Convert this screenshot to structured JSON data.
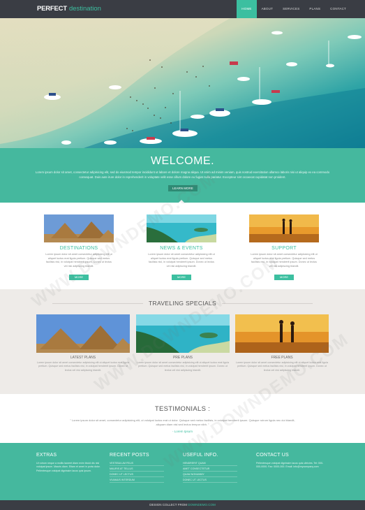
{
  "brand": {
    "logo_bold": "PERFECT",
    "logo_light": "destination"
  },
  "nav": {
    "items": [
      {
        "label": "HOME",
        "active": true
      },
      {
        "label": "ABOUT",
        "active": false
      },
      {
        "label": "SERVICES",
        "active": false
      },
      {
        "label": "PLANS",
        "active": false
      },
      {
        "label": "CONTACT",
        "active": false
      }
    ]
  },
  "welcome": {
    "title": "WELCOME.",
    "text": "Lorem ipsum dolor sit amet, consectetur adipisicing elit, sed do eiusmod tempor incididunt ut labore et dolore magna aliqua. Ut enim ad minim veniam, quis nostrud exercitation ullamco laboris nisi ut aliquip ex ea commodo consequat. Duis aute irure dolor in reprehenderit in voluptate velit esse cillum dolore eu fugiat nulla pariatur. Excepteur sint occaecat cupidatat non proident.",
    "button": "LEARN MORE"
  },
  "services": [
    {
      "title": "DESTINATIONS",
      "text": "Lorem ipsum dolor sit amet consectetur adipisicing elit ut aliquet luctus erat ligula pretium. Quisque sed metus facilisis nisl, in volutpat hendrerit ipsum. Donec ut lectus vel nisi adipiscing blandit.",
      "button": "MORE"
    },
    {
      "title": "NEWS & EVENTS",
      "text": "Lorem ipsum dolor sit amet consectetur adipisicing elit ut aliquet luctus erat ligula pretium. Quisque sed metus facilisis nisl, in volutpat hendrerit ipsum. Donec ut lectus vel nisi adipiscing blandit.",
      "button": "MORE"
    },
    {
      "title": "SUPPORT",
      "text": "Lorem ipsum dolor sit amet consectetur adipisicing elit ut aliquet luctus erat ligula pretium. Quisque sed metus facilisis nisl, in volutpat hendrerit ipsum. Donec ut lectus vel nisi adipiscing blandit.",
      "button": "MORE"
    }
  ],
  "specials": {
    "title": "TRAVELING SPECIALS",
    "plans": [
      {
        "title": "LATEST PLANS",
        "text": "Lorem ipsum dolor sit amet consectetur adipisicing elit ut aliquet luctus erat ligula pretium. Quisque sed metus facilisis nisl, in volutpat hendrerit ipsum. Donec ut lectus vel nisi adipiscing blandit."
      },
      {
        "title": "PRE PLANS",
        "text": "Lorem ipsum dolor sit amet consectetur adipisicing elit ut aliquet luctus erat ligula pretium. Quisque sed metus facilisis nisl, in volutpat hendrerit ipsum. Donec ut lectus vel nisi adipiscing blandit."
      },
      {
        "title": "FREE PLANS",
        "text": "Lorem ipsum dolor sit amet consectetur adipisicing elit ut aliquet luctus erat ligula pretium. Quisque sed metus facilisis nisl, in volutpat hendrerit ipsum. Donec ut lectus vel nisi adipiscing blandit."
      }
    ]
  },
  "testimonials": {
    "title": "TESTIMONIALS :",
    "quote": "\" Lorem ipsum dolor sit amet, consectetur adipisicing elit, ut volutpat luctus erat ut dolor. Quisque sed metus facilisis, in volutpat hendrerit ipsum. Quisque rutrum ligula nec dui blandit, aliquam diam nisl sed lectus tempor nibh. \"",
    "author": "- Lorem Ipsum"
  },
  "footer": {
    "extras": {
      "title": "EXTRAS",
      "text": "Ut rutrum neque a mollis laoreet diam enim tincid dis nisl volutpat ipsum. Mauris diam. Etiam et amet in porta dolor. Pellentesque volutpat dignissim lacus quis ipsum."
    },
    "recent": {
      "title": "RECENT POSTS",
      "links": [
        "VESTIBULUM FELIS",
        "MAURIS AT TELLUS",
        "DONEC UT LECTUS",
        "VIVAMUS INTERDUM"
      ]
    },
    "useful": {
      "title": "USEFUL INFO.",
      "links": [
        "HENDRERIT QUAM",
        "AMET CONSECTETUR",
        "QUAM NONUMMY",
        "DONEC UT LECTUS"
      ]
    },
    "contact": {
      "title": "CONTACT US",
      "text": "Pellentesque volutpat dignissim lacus quis ultricies. Tel: 000-000-0000. Fax: 0000-000. Email: info@mycompany.com"
    }
  },
  "bottom": {
    "text": "DESIGN COLLECT FROM",
    "link": "DOWNDEMO.COM"
  },
  "watermark": "WWW.DOWNDEMO.COM",
  "colors": {
    "accent": "#3cbfa0",
    "band": "#45b89e",
    "dark": "#3a3d44",
    "specials_bg": "#eeebe8"
  }
}
